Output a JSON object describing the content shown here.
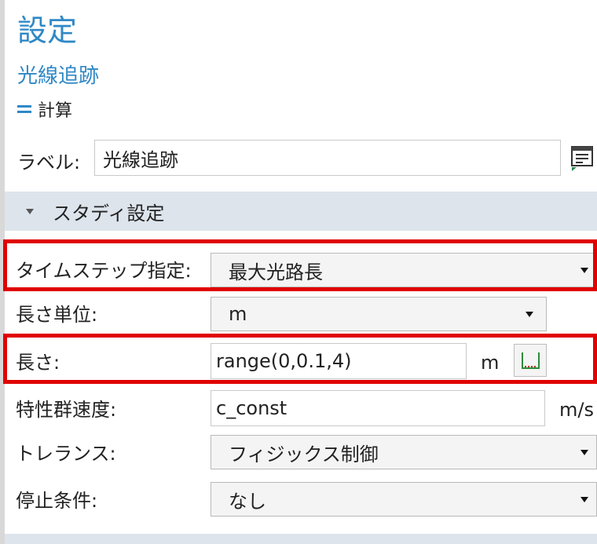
{
  "header": {
    "title": "設定",
    "subtitle": "光線追跡",
    "compute_label": "計算"
  },
  "label_row": {
    "label": "ラベル:",
    "value": "光線追跡"
  },
  "section": {
    "title": "スタディ設定"
  },
  "rows": {
    "timestep": {
      "label": "タイムステップ指定:",
      "value": "最大光路長"
    },
    "length_unit": {
      "label": "長さ単位:",
      "value": "m"
    },
    "length": {
      "label": "長さ:",
      "value": "range(0,0.1,4)",
      "unit": "m"
    },
    "group_velocity": {
      "label": "特性群速度:",
      "value": "c_const",
      "unit": "m/s"
    },
    "tolerance": {
      "label": "トレランス:",
      "value": "フィジックス制御"
    },
    "stop_condition": {
      "label": "停止条件:",
      "value": "なし"
    }
  },
  "colors": {
    "accent": "#2f88c6",
    "section_bg": "#dde4ec",
    "highlight": "#e00000"
  }
}
